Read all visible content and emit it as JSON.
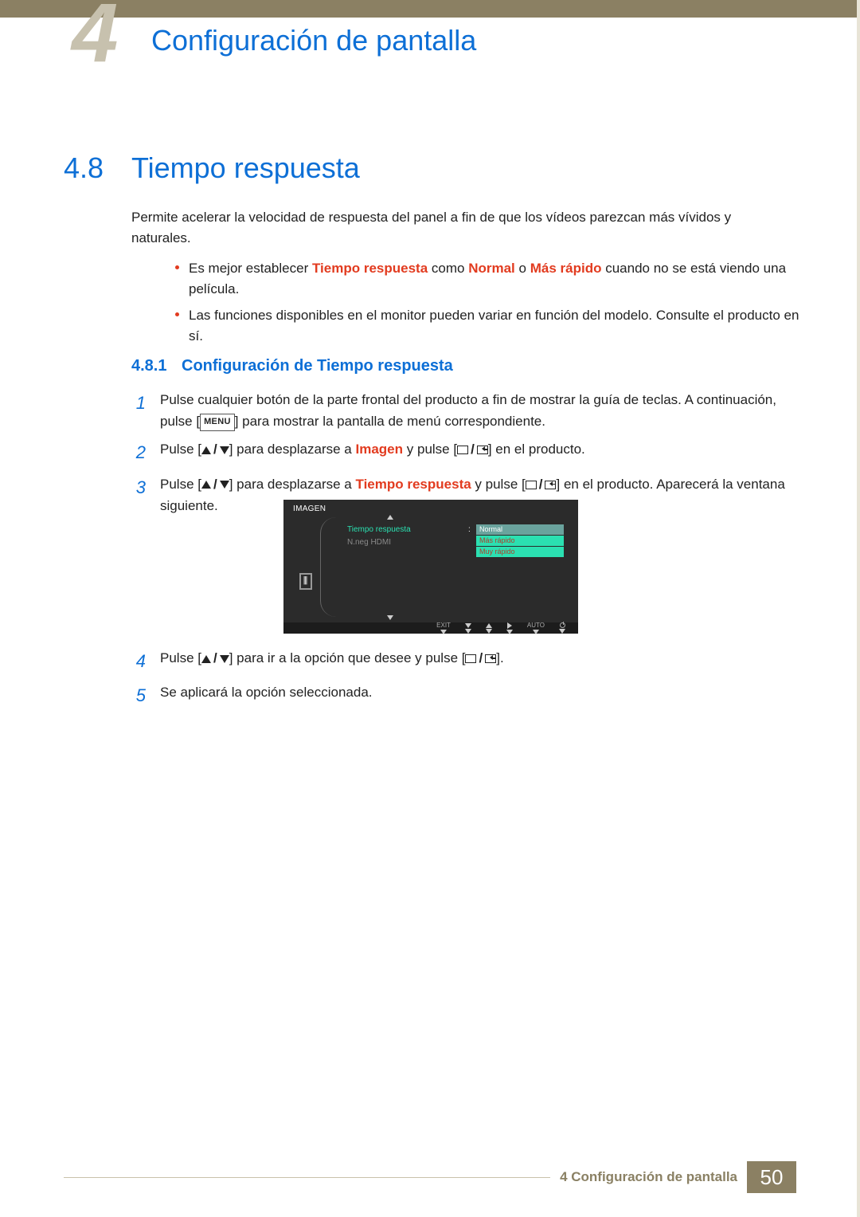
{
  "header": {
    "chapter_num": "4",
    "chapter_title": "Configuración de pantalla"
  },
  "section": {
    "num": "4.8",
    "title": "Tiempo respuesta",
    "intro": "Permite acelerar la velocidad de respuesta del panel a fin de que los vídeos parezcan más vívidos y naturales."
  },
  "notes": [
    {
      "a": "Es mejor establecer",
      "hl1": "Tiempo respuesta",
      "b": "como",
      "hl2": "Normal",
      "c": "o",
      "hl3": "Más rápido",
      "d": "cuando no se está viendo una película."
    },
    {
      "text": "Las funciones disponibles en el monitor pueden variar en función del modelo. Consulte el producto en sí."
    }
  ],
  "subsection": {
    "num": "4.8.1",
    "title": "Configuración de Tiempo respuesta"
  },
  "keys": {
    "menu": "MENU"
  },
  "steps": [
    {
      "n": "1",
      "a": "Pulse cualquier botón de la parte frontal del producto a fin de mostrar la guía de teclas. A continuación, pulse",
      "b": "para mostrar la pantalla de menú correspondiente."
    },
    {
      "n": "2",
      "a": "Pulse",
      "b": "para desplazarse a",
      "hl": "Imagen",
      "c": "y pulse",
      "d": "en el producto."
    },
    {
      "n": "3",
      "a": "Pulse",
      "b": "para desplazarse a",
      "hl": "Tiempo respuesta",
      "c": "y pulse",
      "d": "en el producto. Aparecerá la ventana siguiente."
    },
    {
      "n": "4",
      "a": "Pulse",
      "b": "para ir a la opción que desee y pulse"
    },
    {
      "n": "5",
      "a": "Se aplicará la opción seleccionada."
    }
  ],
  "osd": {
    "title": "IMAGEN",
    "menu": [
      "Tiempo respuesta",
      "N.neg HDMI"
    ],
    "options": [
      "Normal",
      "Más rápido",
      "Muy rápido"
    ],
    "footer": [
      "EXIT",
      "AUTO"
    ]
  },
  "footer": {
    "chapter": "4 Configuración de pantalla",
    "page": "50"
  }
}
